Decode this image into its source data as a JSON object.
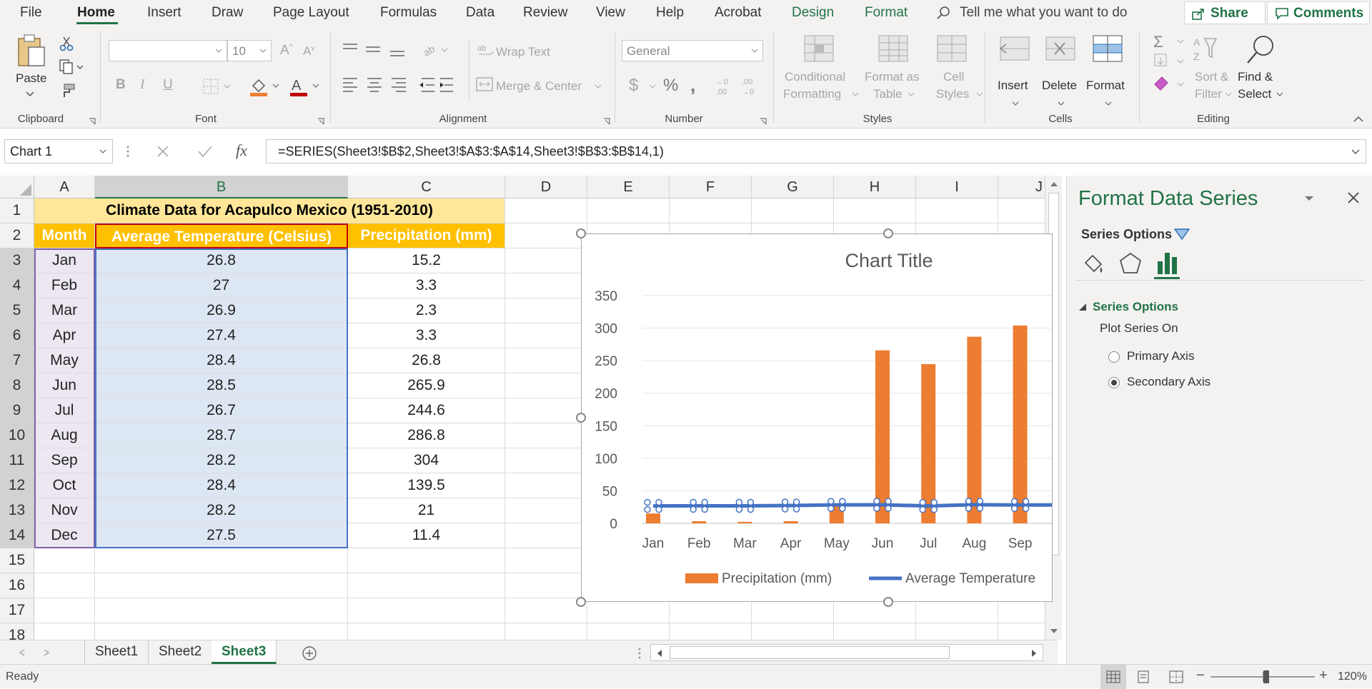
{
  "menu": {
    "tabs": [
      "File",
      "Home",
      "Insert",
      "Draw",
      "Page Layout",
      "Formulas",
      "Data",
      "Review",
      "View",
      "Help",
      "Acrobat",
      "Design",
      "Format"
    ],
    "active": "Home",
    "tell_me": "Tell me what you want to do",
    "share": "Share",
    "comments": "Comments"
  },
  "ribbon": {
    "clipboard": {
      "label": "Clipboard",
      "paste": "Paste"
    },
    "font": {
      "label": "Font",
      "size": "10",
      "bold": "B",
      "italic": "I",
      "underline": "U"
    },
    "alignment": {
      "label": "Alignment",
      "wrap": "Wrap Text",
      "merge": "Merge & Center"
    },
    "number": {
      "label": "Number",
      "format": "General"
    },
    "styles": {
      "label": "Styles",
      "conditional": [
        "Conditional",
        "Formatting"
      ],
      "format_table": [
        "Format as",
        "Table"
      ],
      "cell_styles": [
        "Cell",
        "Styles"
      ]
    },
    "cells": {
      "label": "Cells",
      "insert": "Insert",
      "delete": "Delete",
      "format": "Format"
    },
    "editing": {
      "label": "Editing",
      "sort": [
        "Sort &",
        "Filter"
      ],
      "find": [
        "Find &",
        "Select"
      ]
    }
  },
  "formula_bar": {
    "name_box": "Chart 1",
    "formula": "=SERIES(Sheet3!$B$2,Sheet3!$A$3:$A$14,Sheet3!$B$3:$B$14,1)"
  },
  "sheet": {
    "columns": [
      "A",
      "B",
      "C",
      "D",
      "E",
      "F",
      "G",
      "H",
      "I",
      "J"
    ],
    "rows": [
      "1",
      "2",
      "3",
      "4",
      "5",
      "6",
      "7",
      "8",
      "9",
      "10",
      "11",
      "12",
      "13",
      "14",
      "15",
      "16",
      "17",
      "18"
    ],
    "title": "Climate Data for Acapulco Mexico (1951-2010)",
    "headers": [
      "Month",
      "Average Temperature (Celsius)",
      "Precipitation (mm)"
    ],
    "data": [
      [
        "Jan",
        "26.8",
        "15.2"
      ],
      [
        "Feb",
        "27",
        "3.3"
      ],
      [
        "Mar",
        "26.9",
        "2.3"
      ],
      [
        "Apr",
        "27.4",
        "3.3"
      ],
      [
        "May",
        "28.4",
        "26.8"
      ],
      [
        "Jun",
        "28.5",
        "265.9"
      ],
      [
        "Jul",
        "26.7",
        "244.6"
      ],
      [
        "Aug",
        "28.7",
        "286.8"
      ],
      [
        "Sep",
        "28.2",
        "304"
      ],
      [
        "Oct",
        "28.4",
        "139.5"
      ],
      [
        "Nov",
        "28.2",
        "21"
      ],
      [
        "Dec",
        "27.5",
        "11.4"
      ]
    ]
  },
  "chart_data": {
    "type": "bar",
    "title": "Chart Title",
    "categories": [
      "Jan",
      "Feb",
      "Mar",
      "Apr",
      "May",
      "Jun",
      "Jul",
      "Aug",
      "Sep"
    ],
    "series": [
      {
        "name": "Precipitation (mm)",
        "type": "bar",
        "color": "#ed7d31",
        "values": [
          15.2,
          3.3,
          2.3,
          3.3,
          26.8,
          265.9,
          244.6,
          286.8,
          304
        ]
      },
      {
        "name": "Average Temperature",
        "type": "line",
        "color": "#4472c4",
        "values": [
          26.8,
          27,
          26.9,
          27.4,
          28.4,
          28.5,
          26.7,
          28.7,
          28.2
        ]
      }
    ],
    "yticks": [
      0,
      50,
      100,
      150,
      200,
      250,
      300,
      350
    ],
    "ylim": [
      0,
      350
    ],
    "legend": "bottom"
  },
  "tabs": {
    "sheets": [
      "Sheet1",
      "Sheet2",
      "Sheet3"
    ],
    "active": "Sheet3"
  },
  "status": {
    "ready": "Ready",
    "zoom": "120%"
  },
  "pane": {
    "title": "Format Data Series",
    "series_options_menu": "Series Options",
    "section": "Series Options",
    "plot_on": "Plot Series On",
    "primary": "Primary Axis",
    "secondary": "Secondary Axis",
    "selected": "secondary"
  },
  "colors": {
    "accent": "#217346",
    "bar": "#ed7d31",
    "line": "#4472c4",
    "title_fill": "#ffe699",
    "header_fill": "#ffc000"
  }
}
